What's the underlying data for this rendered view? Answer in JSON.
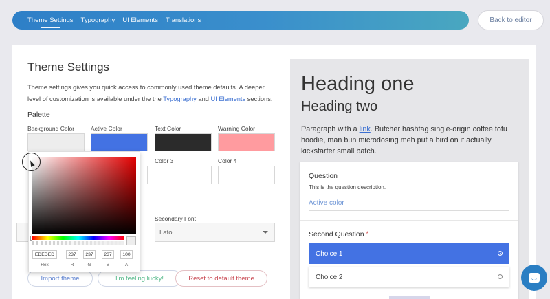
{
  "topbar": {
    "tabs": [
      {
        "label": "Theme Settings",
        "active": true
      },
      {
        "label": "Typography",
        "active": false
      },
      {
        "label": "UI Elements",
        "active": false
      },
      {
        "label": "Translations",
        "active": false
      }
    ],
    "back_label": "Back to editor"
  },
  "settings": {
    "title": "Theme Settings",
    "desc_before": "Theme settings gives you quick access to commonly used theme defaults. A deeper level of customization is available under the the ",
    "desc_link1": "Typography",
    "desc_and": " and ",
    "desc_link2": "UI Elements",
    "desc_after": " sections.",
    "palette_label": "Palette",
    "colors": {
      "background": {
        "label": "Background Color",
        "value": "#ededed"
      },
      "active": {
        "label": "Active Color",
        "value": "#4372e3"
      },
      "text": {
        "label": "Text Color",
        "value": "#2b2b2b"
      },
      "warning": {
        "label": "Warning Color",
        "value": "#ff9b9f"
      },
      "color3": {
        "label": "Color 3"
      },
      "color4": {
        "label": "Color 4"
      }
    },
    "secondary_font": {
      "label": "Secondary Font",
      "value": "Lato"
    },
    "buttons": {
      "import": "Import theme",
      "lucky": "I'm feeling lucky!",
      "reset": "Reset to default theme"
    }
  },
  "picker": {
    "hex": "EDEDED",
    "r": "237",
    "g": "237",
    "b": "237",
    "a": "100",
    "labels": {
      "hex": "Hex",
      "r": "R",
      "g": "G",
      "b": "B",
      "a": "A"
    }
  },
  "preview": {
    "heading_one": "Heading one",
    "heading_two": "Heading two",
    "para_before": "Paragraph with a ",
    "para_link": "link",
    "para_after": ". Butcher hashtag single-origin coffee tofu hoodie, man bun microdosing meh put a bird on it actually kickstarter small batch.",
    "question": {
      "title": "Question",
      "description": "This is the question description.",
      "input_value": "Active color"
    },
    "question2": {
      "title": "Second Question",
      "required_mark": "*",
      "choices": [
        "Choice 1",
        "Choice 2"
      ],
      "selected_index": 0
    }
  }
}
